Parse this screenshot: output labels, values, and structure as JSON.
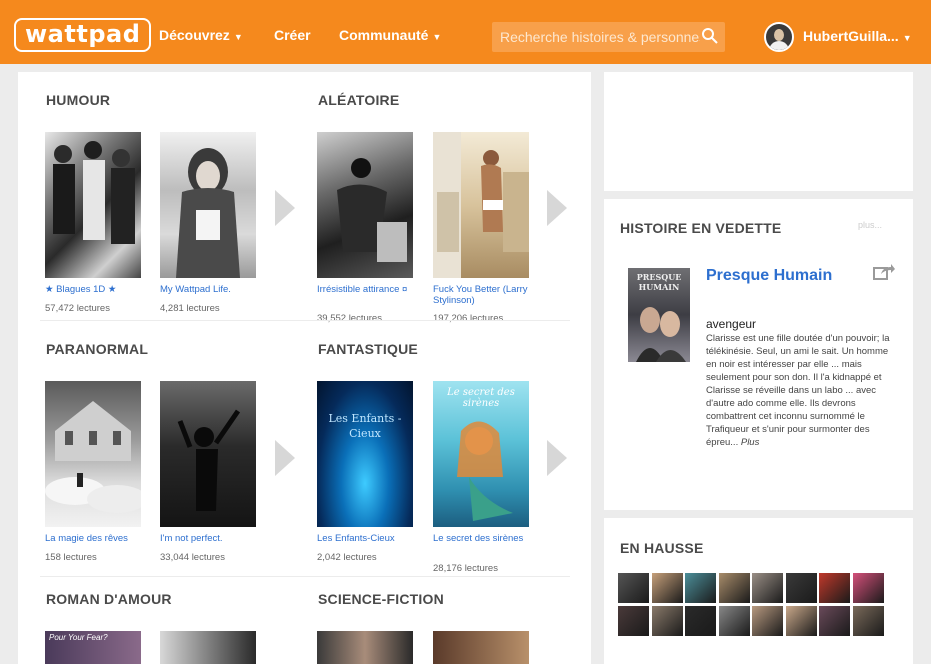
{
  "nav": {
    "logo": "wattpad",
    "discover": "Découvrez",
    "create": "Créer",
    "community": "Communauté",
    "search_placeholder": "Recherche histoires & personnes",
    "username": "HubertGuilla..."
  },
  "sections": [
    {
      "title": "HUMOUR",
      "books": [
        {
          "title": "★ Blagues 1D ★",
          "reads": "57,472 lectures"
        },
        {
          "title": "My Wattpad Life.",
          "reads": "4,281 lectures"
        }
      ]
    },
    {
      "title": "ALÉATOIRE",
      "books": [
        {
          "title": "Irrésistible attirance ¤",
          "reads": "39,552 lectures"
        },
        {
          "title": "Fuck You Better (Larry Stylinson)",
          "reads": "197,206 lectures"
        }
      ]
    },
    {
      "title": "PARANORMAL",
      "books": [
        {
          "title": "La magie des rêves",
          "reads": "158 lectures"
        },
        {
          "title": "I'm not perfect.",
          "reads": "33,044 lectures"
        }
      ]
    },
    {
      "title": "FANTASTIQUE",
      "books": [
        {
          "title": "Les Enfants-Cieux",
          "reads": "2,042 lectures",
          "cover_text": "Les Enfants - Cieux"
        },
        {
          "title": "Le secret des sirènes",
          "reads": "28,176 lectures",
          "cover_text": "Le secret des sirènes"
        }
      ]
    },
    {
      "title": "ROMAN D'AMOUR",
      "books": [
        {
          "cover_text": "Pour Your Fear?"
        },
        {}
      ]
    },
    {
      "title": "SCIENCE-FICTION",
      "books": [
        {},
        {}
      ]
    }
  ],
  "featured": {
    "heading": "HISTOIRE EN VEDETTE",
    "more": "plus...",
    "cover_text": "PRESQUE HUMAIN",
    "title": "Presque Humain",
    "author": "avengeur",
    "description": "Clarisse est une fille doutée d'un pouvoir; la télékinésie. Seul, un ami le sait. Un homme en noir est intéresser par elle ... mais seulement pour son don. Il l'a kidnappé et Clarisse se réveille dans un labo ... avec d'autre ado comme elle. Ils devrons combattrent cet inconnu surnommé le Trafiqueur et s'unir pour surmonter des épreu...",
    "plus": "Plus"
  },
  "trending": {
    "heading": "EN HAUSSE",
    "colors": [
      "#555555",
      "#c6a07a",
      "#4c8f9a",
      "#a88c6a",
      "#9a8f86",
      "#3a3a3a",
      "#c0392b",
      "#d4507a",
      "#4a3a3a",
      "#8a7a6a",
      "#2a2a2a",
      "#888888",
      "#b89a80",
      "#c9a88a",
      "#6a4a5a",
      "#7a6a5a"
    ]
  }
}
